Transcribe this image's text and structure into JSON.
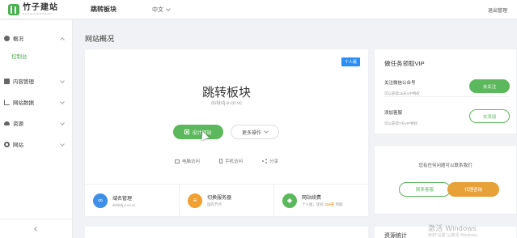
{
  "header": {
    "logo_name": "竹子建站",
    "logo_sub": "ZHUZIJIANZHAN",
    "site_name": "跳转板块",
    "language": "中文",
    "logout": "退出管理"
  },
  "sidebar": {
    "items": [
      {
        "label": "概况",
        "icon": "info-icon",
        "expanded": true
      },
      {
        "label": "内容管理",
        "icon": "document-icon"
      },
      {
        "label": "网站数据",
        "icon": "chart-icon"
      },
      {
        "label": "资源",
        "icon": "cloud-icon"
      },
      {
        "label": "网站",
        "icon": "gear-icon"
      }
    ],
    "sub_active": "控制台"
  },
  "main": {
    "page_title": "网站概况",
    "plan_badge": "个人版",
    "site_title": "跳转板块",
    "site_domain": "dsfdsfj.e.cn.vc",
    "design_button": "设计网站",
    "more_button": "更多操作",
    "quick_links": [
      "电脑访问",
      "手机访问",
      "分享"
    ],
    "info": [
      {
        "title": "域名管理",
        "sub": "dsfdsfj.e.cn.vc",
        "icon": "link-icon"
      },
      {
        "title": "切换服务器",
        "sub": "国内节点",
        "icon": "server-icon"
      },
      {
        "title": "网站续费",
        "sub_prefix": "个人版，还有",
        "days": "319天",
        "sub_suffix": "到期",
        "icon": "diamond-icon"
      }
    ],
    "bottom_left_title": "",
    "accent": "#5cb85c"
  },
  "tasks": {
    "title": "做任务领取VIP",
    "items": [
      {
        "name": "关注微信公众号",
        "sub": "可以获得15天VIP特权",
        "button": "去关注"
      },
      {
        "name": "添加客服",
        "sub": "可以获得7天VIP特权",
        "button": "去添加"
      }
    ]
  },
  "contact": {
    "text": "您有任何问题可以联系我们",
    "service_button": "联系客服",
    "agent_button": "代理咨询"
  },
  "bottom_right_title": "资源统计",
  "watermark": {
    "title": "激活 Windows",
    "sub": "转到“设置”以激活 Windows。"
  }
}
